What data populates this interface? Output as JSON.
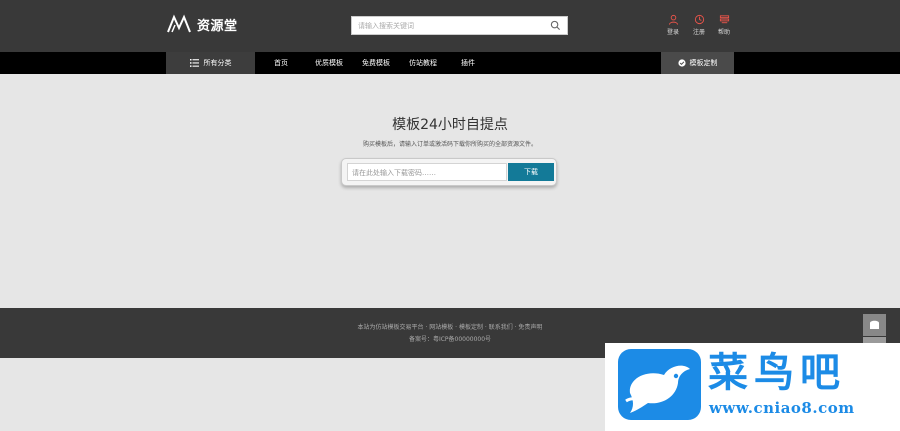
{
  "header": {
    "logo_text": "资源堂",
    "search_placeholder": "请输入搜索关键词",
    "actions": [
      {
        "label": "登录",
        "icon": "user-icon"
      },
      {
        "label": "注册",
        "icon": "register-icon"
      },
      {
        "label": "帮助",
        "icon": "help-icon"
      }
    ]
  },
  "nav": {
    "category_label": "所有分类",
    "links": [
      "首页",
      "优质模板",
      "免费模板",
      "仿站教程",
      "插件"
    ],
    "right_button": "模板定制"
  },
  "hero": {
    "title": "模板24小时自提点",
    "subtitle": "购买模板后，请输入订单或激活码下载你所购买的全部资源文件。",
    "input_placeholder": "请在此处输入下载密码……",
    "button_label": "下载"
  },
  "footer": {
    "line1": "本站为仿站模板交易平台 · 网站模板 · 模板定制 · 联系我们 · 免责声明",
    "line2": "备案号：粤ICP备00000000号"
  },
  "watermark": {
    "title": "菜鸟吧",
    "url": "www.cniao8.com"
  },
  "colors": {
    "header_bg": "#393939",
    "nav_bg": "#000000",
    "accent_button": "#137a98",
    "action_icons": "#e9544a",
    "watermark_blue": "#1c8be6"
  }
}
